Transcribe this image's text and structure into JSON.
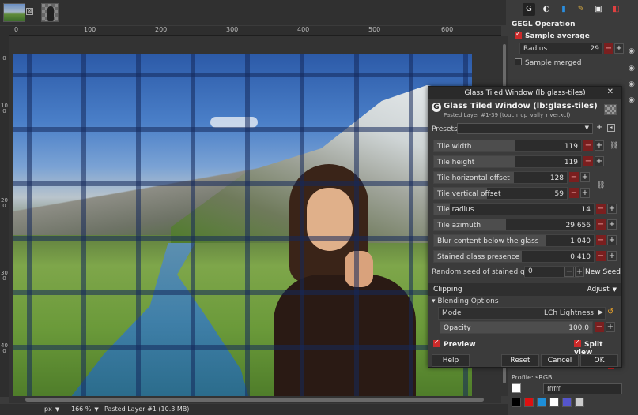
{
  "tabs": {
    "close_glyph": "⊠"
  },
  "ruler_top": [
    "0",
    "100",
    "200",
    "300",
    "400",
    "500",
    "600"
  ],
  "ruler_left": [
    "0",
    "100",
    "200",
    "300",
    "400"
  ],
  "status": {
    "unit": "px",
    "zoom": "166 %",
    "layer": "Pasted Layer #1 (10.3 MB)"
  },
  "dock": {
    "title": "GEGL Operation",
    "sample_average": "Sample average",
    "radius_label": "Radius",
    "radius_value": "29",
    "sample_merged": "Sample merged",
    "profile": "Profile: sRGB",
    "hex": "ffffff",
    "swatch_colors": [
      "#000000",
      "#dd1111",
      "#1e8fd8",
      "#ffffff",
      "#5555cc",
      "#cccccc"
    ]
  },
  "dialog": {
    "window_title": "Glass Tiled Window (lb:glass-tiles)",
    "heading": "Glass Tiled Window (lb:glass-tiles)",
    "subheading": "Pasted Layer #1-39 (touch_up_vally_river.xcf)",
    "presets_label": "Presets:",
    "sliders": [
      {
        "label": "Tile width",
        "value": "119",
        "fill": 0.55
      },
      {
        "label": "Tile height",
        "value": "119",
        "fill": 0.55
      },
      {
        "label": "Tile horizontal offset",
        "value": "128",
        "fill": 0.6
      },
      {
        "label": "Tile vertical offset",
        "value": "59",
        "fill": 0.4
      },
      {
        "label": "Tile radius",
        "value": "14",
        "fill": 0.1
      },
      {
        "label": "Tile azimuth",
        "value": "29.656",
        "fill": 0.45
      },
      {
        "label": "Blur content below the glass",
        "value": "1.040",
        "fill": 0.7
      },
      {
        "label": "Stained glass presence",
        "value": "0.410",
        "fill": 0.55
      }
    ],
    "seed_label": "Random seed of stained glass",
    "seed_value": "0",
    "new_seed": "New Seed",
    "clipping_label": "Clipping",
    "clipping_value": "Adjust",
    "blending_header": "Blending Options",
    "mode_label": "Mode",
    "mode_value": "LCh Lightness",
    "opacity_label": "Opacity",
    "opacity_value": "100.0",
    "preview_label": "Preview",
    "split_label": "Split view",
    "buttons": {
      "help": "Help",
      "reset": "Reset",
      "cancel": "Cancel",
      "ok": "OK"
    }
  }
}
